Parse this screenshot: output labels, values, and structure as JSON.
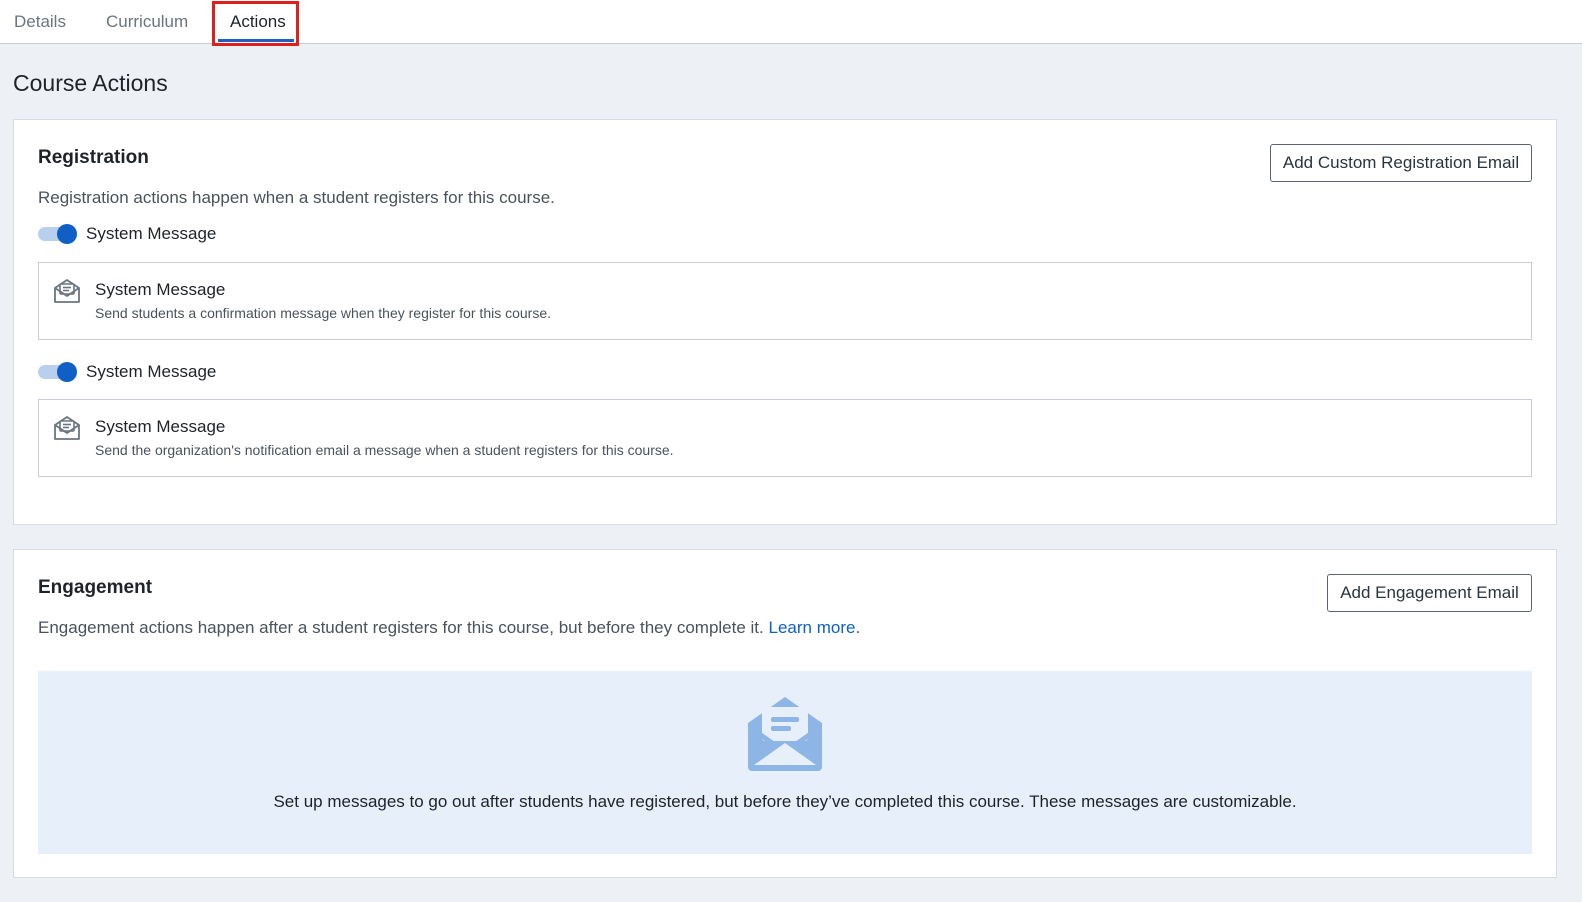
{
  "tabs": {
    "details": "Details",
    "curriculum": "Curriculum",
    "actions": "Actions"
  },
  "page": {
    "title": "Course Actions"
  },
  "registration": {
    "title": "Registration",
    "description": "Registration actions happen when a student registers for this course.",
    "add_button": "Add Custom Registration Email",
    "items": [
      {
        "toggle_label": "System Message",
        "toggle_on": true,
        "title": "System Message",
        "subtitle": "Send students a confirmation message when they register for this course."
      },
      {
        "toggle_label": "System Message",
        "toggle_on": true,
        "title": "System Message",
        "subtitle": "Send the organization's notification email a message when a student registers for this course."
      }
    ]
  },
  "engagement": {
    "title": "Engagement",
    "description": "Engagement actions happen after a student registers for this course, but before they complete it.",
    "learn_more": "Learn more",
    "trailing_period": ".",
    "add_button": "Add Engagement Email",
    "empty_text": "Set up messages to go out after students have registered, but before they’ve completed this course. These messages are customizable."
  },
  "colors": {
    "accent": "#0f5fc6",
    "highlight_box": "#e0201f",
    "empty_panel_bg": "#e6effa",
    "page_bg": "#edf1f5"
  },
  "icons": {
    "message_item": "envelope-open-icon",
    "empty_state": "envelope-open-icon"
  }
}
